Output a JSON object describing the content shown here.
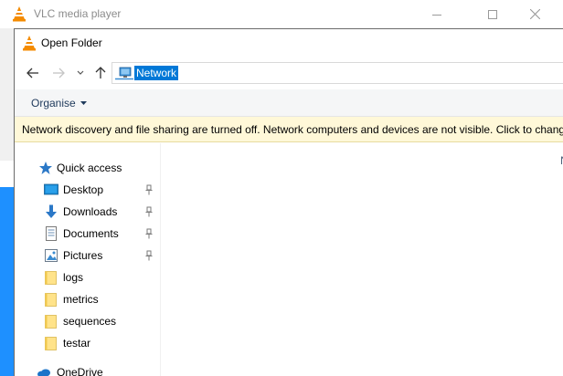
{
  "vlc": {
    "title": "VLC media player"
  },
  "dialog": {
    "title": "Open Folder",
    "address": "Network",
    "organise": "Organise",
    "info_message": "Network discovery and file sharing are turned off. Network computers and devices are not visible. Click to chang",
    "column_header": "N"
  },
  "nav_pane": {
    "quick_access": "Quick access",
    "items": [
      {
        "label": "Desktop",
        "icon": "desktop-icon",
        "pinned": true
      },
      {
        "label": "Downloads",
        "icon": "download-icon",
        "pinned": true
      },
      {
        "label": "Documents",
        "icon": "documents-icon",
        "pinned": true
      },
      {
        "label": "Pictures",
        "icon": "pictures-icon",
        "pinned": true
      },
      {
        "label": "logs",
        "icon": "folder-icon",
        "pinned": false
      },
      {
        "label": "metrics",
        "icon": "folder-icon",
        "pinned": false
      },
      {
        "label": "sequences",
        "icon": "folder-icon",
        "pinned": false
      },
      {
        "label": "testar",
        "icon": "folder-icon",
        "pinned": false
      }
    ],
    "onedrive": "OneDrive"
  },
  "colors": {
    "selection": "#0078d7",
    "info_bar": "#fff8d8",
    "vlc_orange": "#f48b00"
  }
}
